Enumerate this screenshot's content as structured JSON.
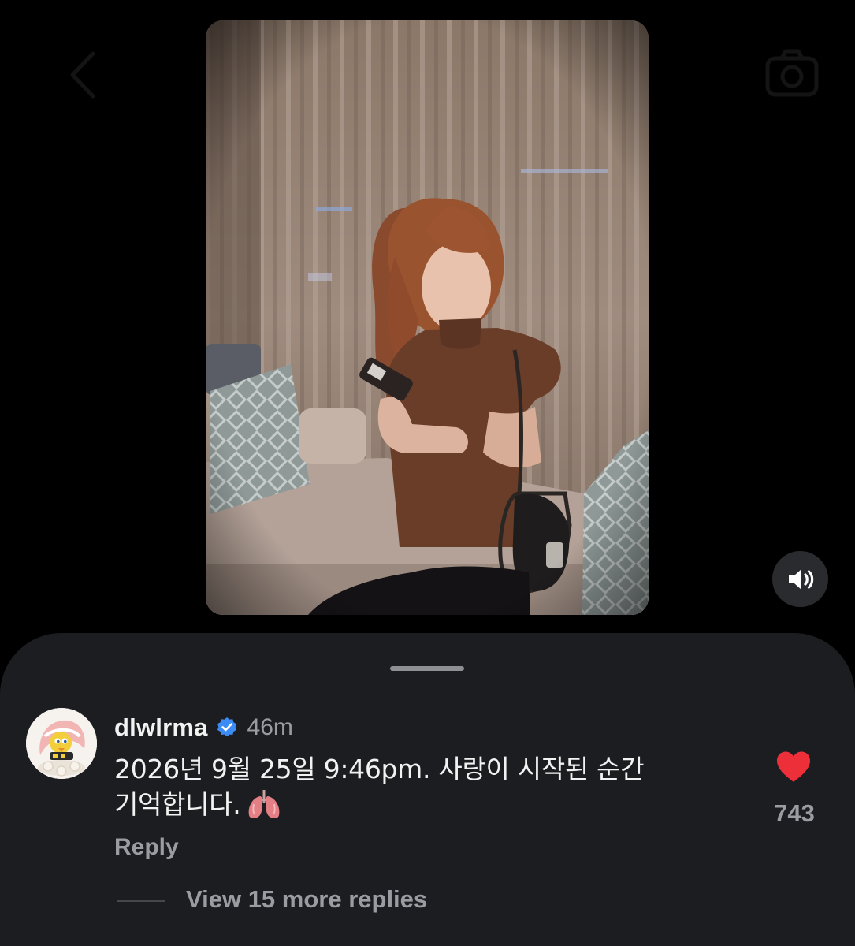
{
  "icons": {
    "back": "chevron-left-icon",
    "camera": "camera-icon",
    "sound": "speaker-on-icon",
    "verified": "verified-badge-icon",
    "like": "heart-filled-icon",
    "emoji": "lungs-emoji"
  },
  "colors": {
    "background": "#000000",
    "sheet": "#1c1d20",
    "verified": "#3d8bf5",
    "like": "#ed2f3a",
    "muted_text": "#9a9ca1"
  },
  "comment": {
    "username": "dlwlrma",
    "timestamp": "46m",
    "text_line1": "2026년 9월 25일 9:46pm. 사랑이 시작된 순간",
    "text_line2": "기억합니다.",
    "like_count": "743",
    "liked": true,
    "reply_label": "Reply",
    "view_replies_label": "View 15 more replies"
  }
}
